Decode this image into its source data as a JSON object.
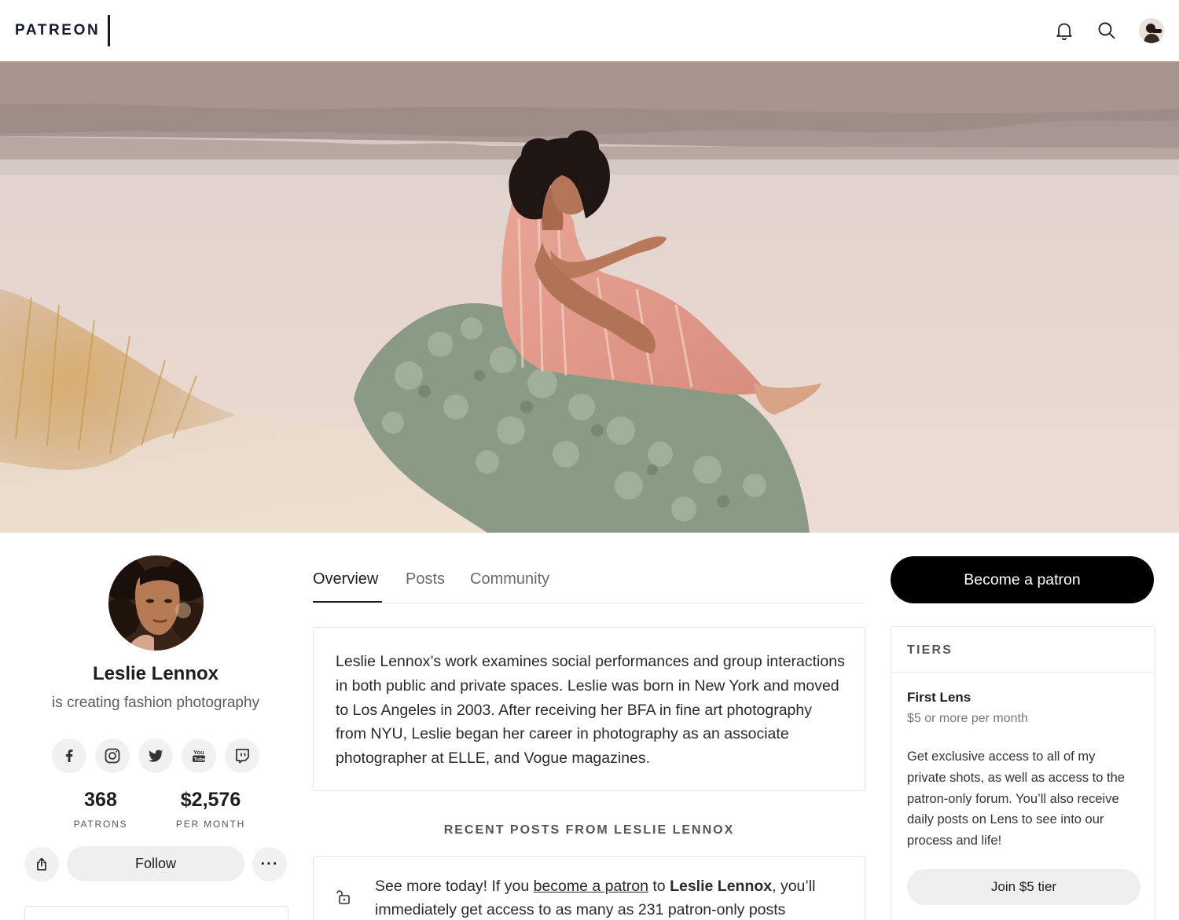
{
  "header": {
    "logo_text": "PATREON",
    "icons": [
      "bell-icon",
      "search-icon",
      "user-avatar"
    ]
  },
  "banner": {
    "image": "cover-photo-woman-seated-on-dune-by-water"
  },
  "creator": {
    "name": "Leslie Lennox",
    "tagline": "is creating fashion photography",
    "socials": [
      "facebook-icon",
      "instagram-icon",
      "twitter-icon",
      "youtube-icon",
      "twitch-icon"
    ],
    "stats": {
      "patrons_value": "368",
      "patrons_label": "PATRONS",
      "income_value": "$2,576",
      "income_label": "PER MONTH"
    },
    "follow_label": "Follow",
    "more_label": "···"
  },
  "tabs": [
    {
      "label": "Overview",
      "active": true
    },
    {
      "label": "Posts",
      "active": false
    },
    {
      "label": "Community",
      "active": false
    }
  ],
  "about": {
    "text": "Leslie Lennox’s work examines social performances and group interactions in both public and private spaces. Leslie was born in New York and moved to Los Angeles in 2003. After receiving her BFA in fine art photography from NYU, Leslie began her career in photography as an associate photographer at ELLE, and Vogue magazines."
  },
  "recent_posts": {
    "title": "RECENT POSTS FROM LESLIE LENNOX",
    "locked_prefix": "See more today! If you ",
    "locked_link": "become a patron",
    "locked_mid": " to ",
    "locked_name": "Leslie Lennox",
    "locked_suffix": ", you’ll immediately get access to as many as 231 patron-only posts"
  },
  "sidebar": {
    "become_patron_label": "Become a patron",
    "tiers_label": "TIERS",
    "tier": {
      "name": "First Lens",
      "price": "$5 or more per month",
      "description": "Get exclusive access to all of my private shots, as well as access to the patron-only forum. You’ll also receive daily posts on Lens to see into our process and life!",
      "join_label": "Join $5 tier"
    }
  },
  "colors": {
    "primary_button": "#000000",
    "secondary_button": "#efefef",
    "logo": "#141a2b"
  }
}
